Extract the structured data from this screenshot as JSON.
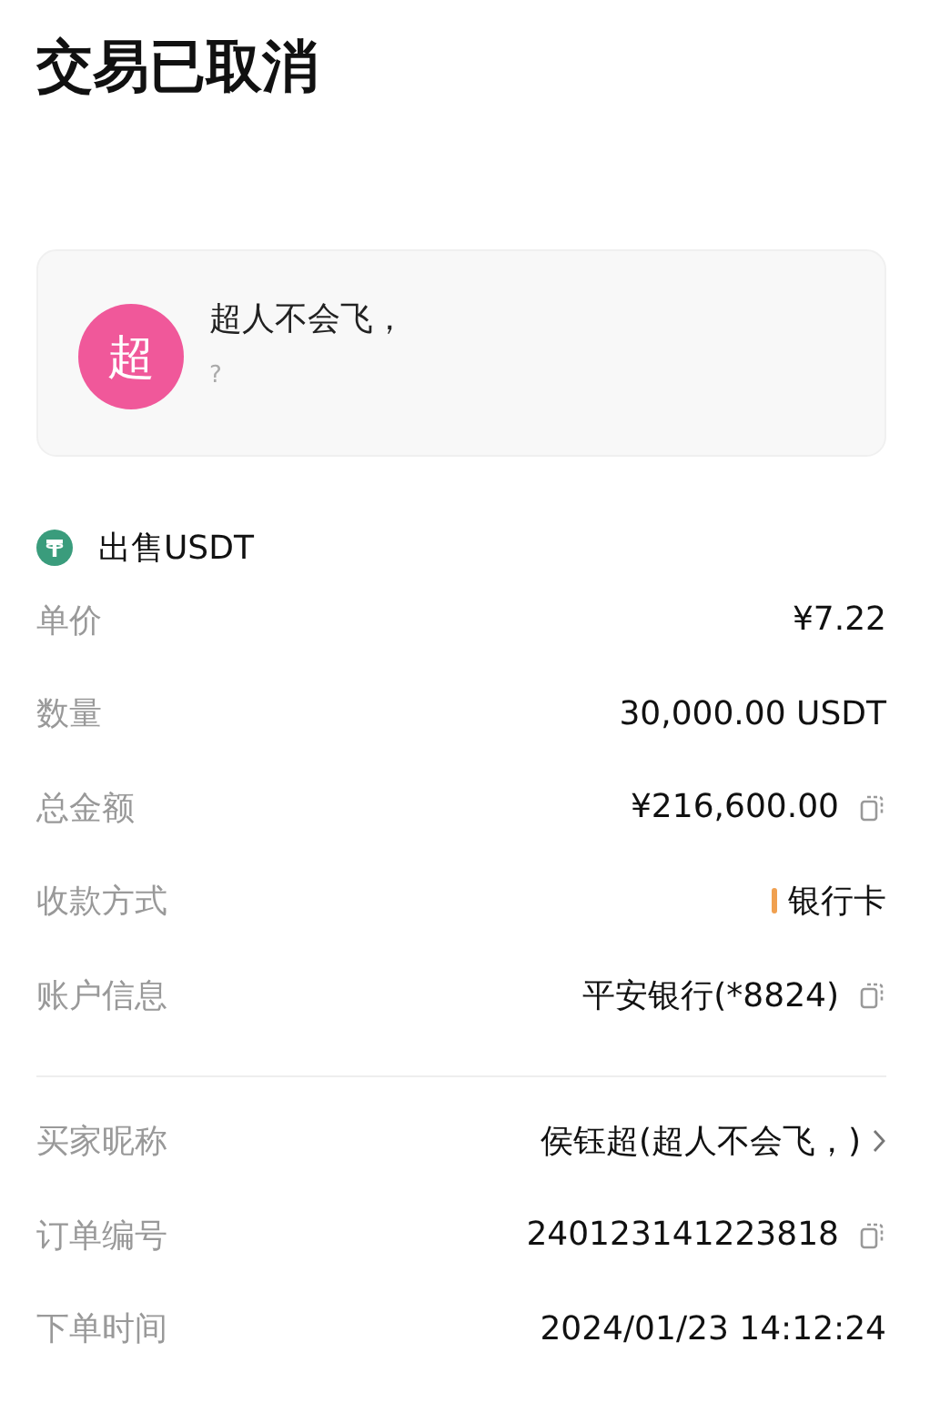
{
  "title": "交易已取消",
  "card": {
    "avatar_text": "超",
    "name": "超人不会飞，",
    "subtitle": "?"
  },
  "asset": {
    "label": "出售USDT"
  },
  "groups": [
    [
      {
        "label": "单价",
        "value": "¥7.22",
        "kind": "plain"
      },
      {
        "label": "数量",
        "value": "30,000.00 USDT",
        "kind": "plain"
      },
      {
        "label": "总金额",
        "value": "¥216,600.00",
        "kind": "copy"
      },
      {
        "label": "收款方式",
        "value": "银行卡",
        "kind": "method"
      },
      {
        "label": "账户信息",
        "value": "平安银行(*8824)",
        "kind": "copy"
      }
    ],
    [
      {
        "label": "买家昵称",
        "value": "侯钰超(超人不会飞，)",
        "kind": "link"
      },
      {
        "label": "订单编号",
        "value": "240123141223818",
        "kind": "copy"
      },
      {
        "label": "下单时间",
        "value": "2024/01/23 14:12:24",
        "kind": "plain"
      }
    ]
  ]
}
